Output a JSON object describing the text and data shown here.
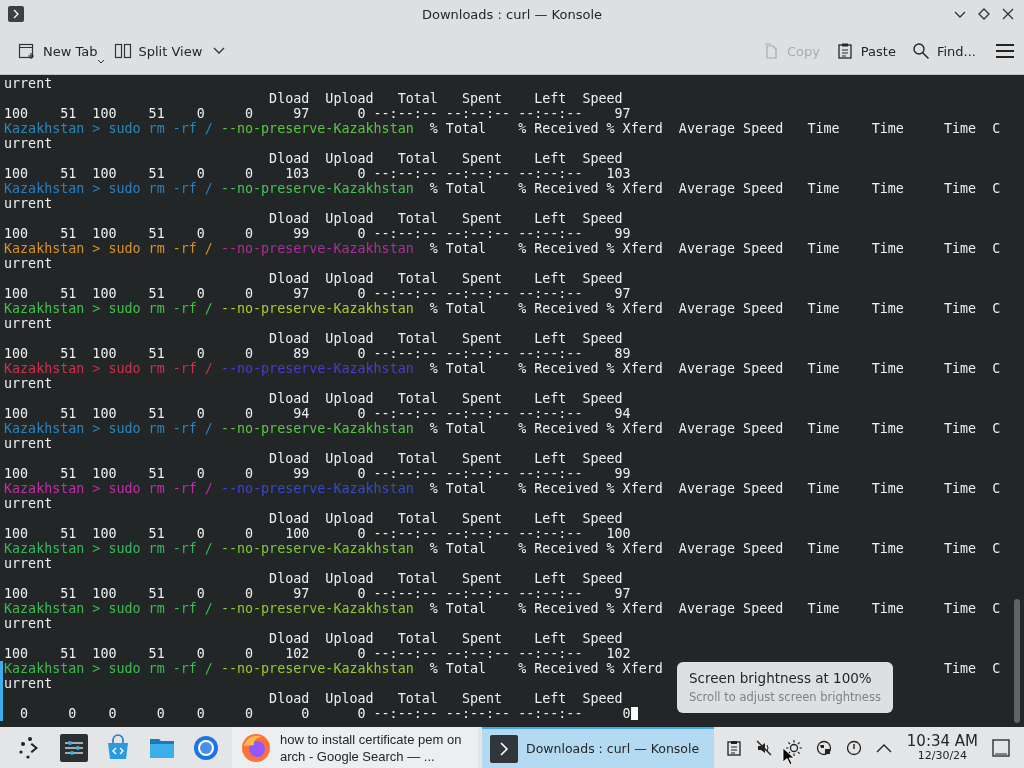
{
  "window": {
    "title": "Downloads : curl — Konsole"
  },
  "toolbar": {
    "left": [
      {
        "label": "New Tab",
        "kind": "newtab",
        "disabled": false
      },
      {
        "label": "Split View",
        "kind": "split",
        "disabled": false
      }
    ],
    "right": [
      {
        "label": "Copy",
        "kind": "copy",
        "disabled": true
      },
      {
        "label": "Paste",
        "kind": "paste",
        "disabled": false
      },
      {
        "label": "Find...",
        "kind": "find",
        "disabled": false
      }
    ]
  },
  "terminal": {
    "lines": [
      {
        "kind": "output",
        "text": "urrent",
        "marked": false
      },
      {
        "kind": "output",
        "text": "                                 Dload  Upload   Total   Spent    Left  Speed",
        "marked": false
      },
      {
        "kind": "output",
        "text": "100    51  100    51    0     0     97      0 --:--:-- --:--:-- --:--:--    97",
        "marked": false
      },
      {
        "kind": "prompt",
        "segments": [
          {
            "text": "Kazakhstan > sudo rm -rf /",
            "color": "#2b87b8"
          },
          {
            "text": "--no-preserve-Kazakhstan",
            "color": "#5cc640"
          }
        ],
        "text": "  % Total    % Received % Xferd  Average Speed   Time    Time     Time  C",
        "marked": false
      },
      {
        "kind": "output",
        "text": "urrent",
        "marked": false
      },
      {
        "kind": "output",
        "text": "                                 Dload  Upload   Total   Spent    Left  Speed",
        "marked": false
      },
      {
        "kind": "output",
        "text": "100    51  100    51    0     0    103      0 --:--:-- --:--:-- --:--:--   103",
        "marked": false
      },
      {
        "kind": "prompt",
        "segments": [
          {
            "text": "Kazakhstan > sudo rm -rf /",
            "color": "#2a7fc0"
          },
          {
            "text": "--no-preserve-Kazakhstan",
            "color": "#4cc058"
          }
        ],
        "text": "  % Total    % Received % Xferd  Average Speed   Time    Time     Time  C",
        "marked": false
      },
      {
        "kind": "output",
        "text": "urrent",
        "marked": false
      },
      {
        "kind": "output",
        "text": "                                 Dload  Upload   Total   Spent    Left  Speed",
        "marked": false
      },
      {
        "kind": "output",
        "text": "100    51  100    51    0     0     99      0 --:--:-- --:--:-- --:--:--    99",
        "marked": false
      },
      {
        "kind": "prompt",
        "segments": [
          {
            "text": "Kazakhstan > sudo rm -rf /",
            "color": "#d8922a"
          },
          {
            "text": "--no-preserve-Kazakhstan",
            "color": "#b02c9c"
          }
        ],
        "text": "  % Total    % Received % Xferd  Average Speed   Time    Time     Time  C",
        "marked": false
      },
      {
        "kind": "output",
        "text": "urrent",
        "marked": false
      },
      {
        "kind": "output",
        "text": "                                 Dload  Upload   Total   Spent    Left  Speed",
        "marked": false
      },
      {
        "kind": "output",
        "text": "100    51  100    51    0     0     97      0 --:--:-- --:--:-- --:--:--    97",
        "marked": false
      },
      {
        "kind": "prompt",
        "segments": [
          {
            "text": "Kazakhstan > sudo rm -rf /",
            "color": "#40c048"
          },
          {
            "text": "--no-preserve-Kazakhstan",
            "color": "#b4c830"
          }
        ],
        "text": "  % Total    % Received % Xferd  Average Speed   Time    Time     Time  C",
        "marked": false
      },
      {
        "kind": "output",
        "text": "urrent",
        "marked": false
      },
      {
        "kind": "output",
        "text": "                                 Dload  Upload   Total   Spent    Left  Speed",
        "marked": false
      },
      {
        "kind": "output",
        "text": "100    51  100    51    0     0     89      0 --:--:-- --:--:-- --:--:--    89",
        "marked": false
      },
      {
        "kind": "prompt",
        "segments": [
          {
            "text": "Kazakhstan > sudo rm -rf /",
            "color": "#d0304a"
          },
          {
            "text": "--no-preserve-Kazakhstan",
            "color": "#4a3cd0"
          }
        ],
        "text": "  % Total    % Received % Xferd  Average Speed   Time    Time     Time  C",
        "marked": false
      },
      {
        "kind": "output",
        "text": "urrent",
        "marked": false
      },
      {
        "kind": "output",
        "text": "                                 Dload  Upload   Total   Spent    Left  Speed",
        "marked": false
      },
      {
        "kind": "output",
        "text": "100    51  100    51    0     0     94      0 --:--:-- --:--:-- --:--:--    94",
        "marked": false
      },
      {
        "kind": "prompt",
        "segments": [
          {
            "text": "Kazakhstan > sudo rm -rf /",
            "color": "#2a86bc"
          },
          {
            "text": "--no-preserve-Kazakhstan",
            "color": "#5ac448"
          }
        ],
        "text": "  % Total    % Received % Xferd  Average Speed   Time    Time     Time  C",
        "marked": false
      },
      {
        "kind": "output",
        "text": "urrent",
        "marked": false
      },
      {
        "kind": "output",
        "text": "                                 Dload  Upload   Total   Spent    Left  Speed",
        "marked": false
      },
      {
        "kind": "output",
        "text": "100    51  100    51    0     0     99      0 --:--:-- --:--:-- --:--:--    99",
        "marked": false
      },
      {
        "kind": "prompt",
        "segments": [
          {
            "text": "Kazakhstan > sudo rm -rf /",
            "color": "#c42ca8"
          },
          {
            "text": "--no-preserve-Kazakhstan",
            "color": "#3848d0"
          }
        ],
        "text": "  % Total    % Received % Xferd  Average Speed   Time    Time     Time  C",
        "marked": false
      },
      {
        "kind": "output",
        "text": "urrent",
        "marked": false
      },
      {
        "kind": "output",
        "text": "                                 Dload  Upload   Total   Spent    Left  Speed",
        "marked": false
      },
      {
        "kind": "output",
        "text": "100    51  100    51    0     0    100      0 --:--:-- --:--:-- --:--:--   100",
        "marked": false
      },
      {
        "kind": "prompt",
        "segments": [
          {
            "text": "Kazakhstan > sudo rm -rf /",
            "color": "#34b85c"
          },
          {
            "text": "--no-preserve-Kazakhstan",
            "color": "#7cca38"
          }
        ],
        "text": "  % Total    % Received % Xferd  Average Speed   Time    Time     Time  C",
        "marked": false
      },
      {
        "kind": "output",
        "text": "urrent",
        "marked": false
      },
      {
        "kind": "output",
        "text": "                                 Dload  Upload   Total   Spent    Left  Speed",
        "marked": false
      },
      {
        "kind": "output",
        "text": "100    51  100    51    0     0     97      0 --:--:-- --:--:-- --:--:--    97",
        "marked": false
      },
      {
        "kind": "prompt",
        "segments": [
          {
            "text": "Kazakhstan > sudo rm -rf /",
            "color": "#3cbc50"
          },
          {
            "text": "--no-preserve-Kazakhstan",
            "color": "#90c834"
          }
        ],
        "text": "  % Total    % Received % Xferd  Average Speed   Time    Time     Time  C",
        "marked": false
      },
      {
        "kind": "output",
        "text": "urrent",
        "marked": false
      },
      {
        "kind": "output",
        "text": "                                 Dload  Upload   Total   Spent    Left  Speed",
        "marked": false
      },
      {
        "kind": "output",
        "text": "100    51  100    51    0     0    102      0 --:--:-- --:--:-- --:--:--   102",
        "marked": false
      },
      {
        "kind": "prompt",
        "segments": [
          {
            "text": "Kazakhstan > sudo rm -rf /",
            "color": "#3cbc50"
          },
          {
            "text": "--no-preserve-Kazakhstan",
            "color": "#9cc834"
          }
        ],
        "text": "  % Total    % Received % Xferd  ",
        "tail": "Time  C",
        "marked": true
      },
      {
        "kind": "output",
        "text": "urrent",
        "marked": true
      },
      {
        "kind": "output",
        "text": "                                 Dload  Upload   Total   Spent    Left  Speed",
        "marked": true
      },
      {
        "kind": "cursor",
        "text": "  0     0    0     0    0     0      0      0 --:--:-- --:--:-- --:--:--     0",
        "marked": true
      }
    ]
  },
  "tooltip": {
    "title": "Screen brightness at 100%",
    "subtitle": "Scroll to adjust screen brightness"
  },
  "taskbar": {
    "launchers": [
      {
        "kind": "launcher"
      },
      {
        "kind": "settings"
      },
      {
        "kind": "store"
      },
      {
        "kind": "folder"
      },
      {
        "kind": "browser"
      }
    ],
    "tasks": [
      {
        "kind": "firefox",
        "label": "how to install certificate pem on arch - Google Search — ...",
        "selected": false
      },
      {
        "kind": "terminal",
        "label": "Downloads : curl — Konsole",
        "selected": true
      }
    ],
    "tray": [
      {
        "kind": "clipboard"
      },
      {
        "kind": "muted"
      },
      {
        "kind": "brightness"
      },
      {
        "kind": "network"
      },
      {
        "kind": "updates"
      },
      {
        "kind": "expand"
      }
    ],
    "time": "10:34 AM",
    "date": "12/30/24"
  }
}
